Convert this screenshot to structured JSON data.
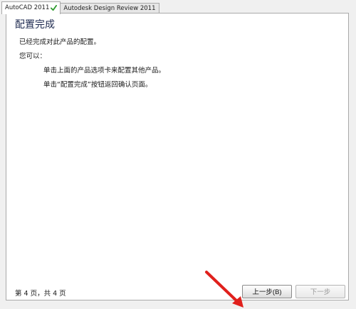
{
  "tabs": [
    {
      "label": "AutoCAD 2011",
      "check": true
    },
    {
      "label": "Autodesk Design Review 2011"
    }
  ],
  "page": {
    "title": "配置完成",
    "line1": "已经完成对此产品的配置。",
    "line2": "您可以：",
    "bullets": [
      "单击上面的产品选项卡来配置其他产品。",
      "单击“配置完成”按钮返回确认页面。"
    ],
    "page_indicator": "第 4 页，共 4 页"
  },
  "buttons": {
    "prev": "上一步(B)",
    "next": "下一步"
  },
  "colors": {
    "accent_arrow": "#e0201c",
    "check_green": "#2e9b2e",
    "title_color": "#1e2a50"
  }
}
